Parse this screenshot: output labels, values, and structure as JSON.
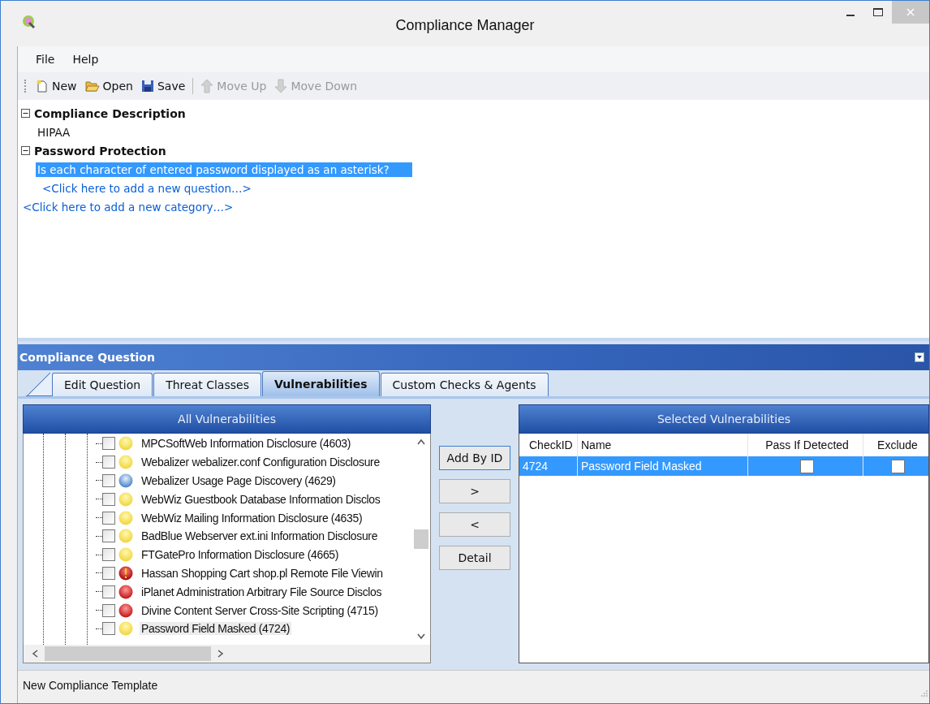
{
  "window": {
    "title": "Compliance Manager"
  },
  "menu": [
    "File",
    "Help"
  ],
  "toolbar": [
    {
      "label": "New",
      "disabled": false
    },
    {
      "label": "Open",
      "disabled": false
    },
    {
      "label": "Save",
      "disabled": false
    },
    {
      "label": "Move Up",
      "disabled": true
    },
    {
      "label": "Move Down",
      "disabled": true
    }
  ],
  "tree": [
    {
      "title": "Compliance Description",
      "expanded": true,
      "items": [
        {
          "text": "HIPAA",
          "kind": "text",
          "selected": false
        }
      ]
    },
    {
      "title": "Password Protection",
      "expanded": true,
      "items": [
        {
          "text": "Is each character of entered password displayed as an asterisk?",
          "kind": "question",
          "selected": true
        },
        {
          "text": "<Click here to add a new question…>",
          "kind": "link",
          "selected": false
        }
      ]
    }
  ],
  "add_category": "<Click here to add a new category…>",
  "panel": {
    "title": "Compliance Question",
    "tabs": [
      {
        "label": "Edit Question",
        "selected": false
      },
      {
        "label": "Threat Classes",
        "selected": false
      },
      {
        "label": "Vulnerabilities",
        "selected": true
      },
      {
        "label": "Custom Checks & Agents",
        "selected": false
      }
    ],
    "all_title": "All Vulnerabilities",
    "vulnerabilities": [
      {
        "name": "MPCSoftWeb Information Disclosure (4603)",
        "kind": "medium",
        "checked": false,
        "selected": false
      },
      {
        "name": "Webalizer webalizer.conf Configuration Disclosure",
        "kind": "medium",
        "checked": false,
        "selected": false
      },
      {
        "name": "Webalizer Usage Page Discovery (4629)",
        "kind": "low",
        "checked": false,
        "selected": false
      },
      {
        "name": "WebWiz Guestbook Database Information Disclos",
        "kind": "medium",
        "checked": false,
        "selected": false
      },
      {
        "name": "WebWiz Mailing Information Disclosure (4635)",
        "kind": "medium",
        "checked": false,
        "selected": false
      },
      {
        "name": "BadBlue Webserver ext.ini Information Disclosure",
        "kind": "medium",
        "checked": false,
        "selected": false
      },
      {
        "name": "FTGatePro Information Disclosure (4665)",
        "kind": "medium",
        "checked": false,
        "selected": false
      },
      {
        "name": "Hassan Shopping Cart shop.pl Remote File Viewin",
        "kind": "critical",
        "checked": false,
        "selected": false
      },
      {
        "name": "iPlanet Administration Arbitrary File Source Disclos",
        "kind": "high",
        "checked": false,
        "selected": false
      },
      {
        "name": "Divine Content Server Cross-Site Scripting (4715)",
        "kind": "high",
        "checked": false,
        "selected": false
      },
      {
        "name": "Password Field Masked (4724)",
        "kind": "medium",
        "checked": false,
        "selected": true
      }
    ],
    "buttons": [
      "Add By ID",
      ">",
      "<",
      "Detail"
    ],
    "selected_title": "Selected Vulnerabilities",
    "columns": [
      "CheckID",
      "Name",
      "Pass If Detected",
      "Exclude"
    ],
    "rows": [
      {
        "check_id": "4724",
        "name": "Password Field Masked",
        "pass_if_detected": false,
        "exclude": false,
        "selected": true
      }
    ]
  },
  "status_bar": "New Compliance Template"
}
